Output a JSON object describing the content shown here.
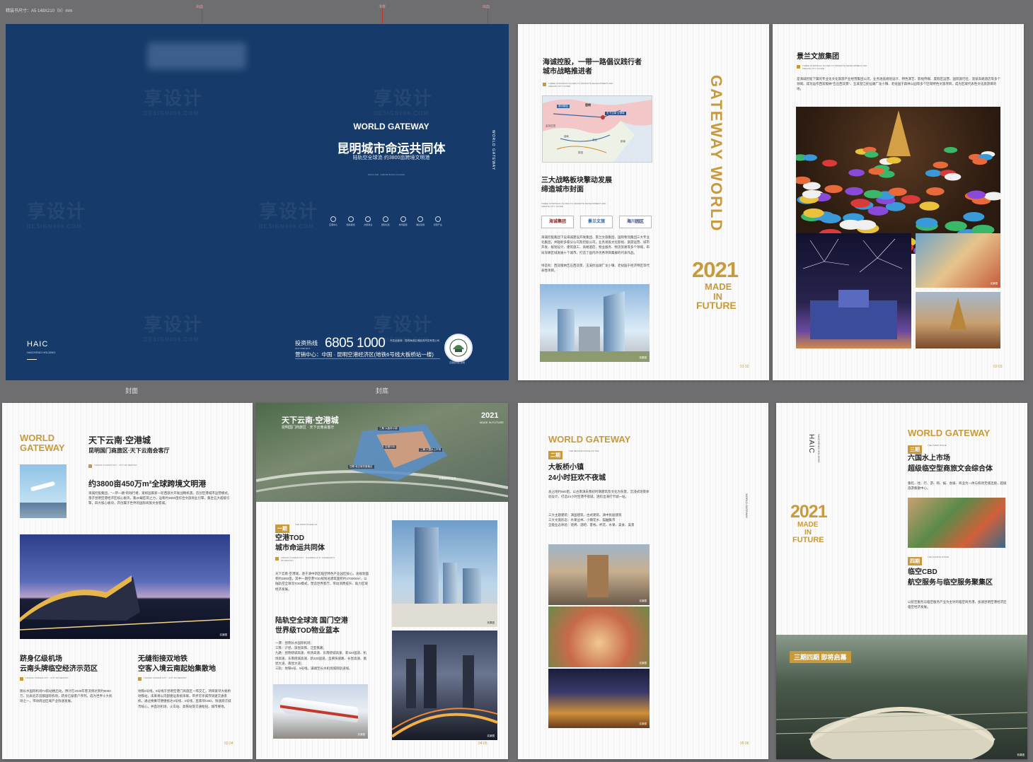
{
  "spec_label": "精装书尺寸：A5 148X210（h）mm",
  "guide_labels": [
    "出血",
    "书脊",
    "出血"
  ],
  "cover": {
    "world_gateway": "WORLD GATEWAY",
    "title": "昆明城市命运共同体",
    "subtitle": "陆轨空全球流·约3800亩跨境文明港",
    "tiny_en": "Airport Hub · Cultural Tourism Complex",
    "feature_icons": [
      "空港中心",
      "陆轨枢纽",
      "文旅商业",
      "国际社区",
      "休闲度假",
      "跨境贸易",
      "智慧产业"
    ],
    "hotline_label": "投资热线",
    "hotline_en": "HOT LINE 0871",
    "phone": "6805 1000",
    "developer": "开发运营商：昆明海诚空港投资开发有限公司",
    "sales_center": "营销中心：中国 · 昆明空港经济区(地铁6号线大板桥站一楼)",
    "brand": "HAIC",
    "brand_sub": "HAICHENG HOLDING",
    "spine": "WORLD GATEWAY",
    "seal_text": "空港经济区·昆明",
    "label_front": "封面",
    "label_back": "封底"
  },
  "p1": {
    "title": "海诚控股，一带一路倡议践行者\n城市战略推进者",
    "title_en": "THREE STRATEGIC PLATES TO PROMOTE DEVELOPMENT AND CREATE CITY COVER",
    "map_labels": [
      "昆明",
      "滇中新区",
      "天下云南·空港城",
      "孟加拉国",
      "缅甸",
      "老挝",
      "泰国",
      "越南"
    ],
    "heading2": "三大战略板块擎动发展\n缔造城市封面",
    "logos": [
      "海诚集团",
      "景兰文旅",
      "海川园区"
    ],
    "body": "海诚控股集团下设海诚建设开发集团、景兰文旅集团、国际物流集团三大专业化集团，并辐射多家分公司及控股公司，业务涵盖文化影视、旅游运营、城市开发、规划设计、建筑施工、高端酒店、物业服务、物流贸易等多个领域，布局深耕区域发展十个城市，打造了国内外优秀项目集群的代表作品。",
    "body2": "缔造有：西双版纳告庄西双景、玉溪抚仙湖广龙小镇、老挝国于经济特区等代表性项目。",
    "caption": "效果图",
    "vertical": "GATEWAY WORLD",
    "year": "2021",
    "made": "MADE",
    "in": "IN",
    "future": "FUTURE",
    "page_num": "01 02"
  },
  "p2": {
    "title": "景兰文旅集团",
    "title_en": "THREE STRATEGIC PLATES TO PROMOTE DEVELOPMENT AND CREATE CITY COVER",
    "body": "是海诚控股下属的专业化文化旅游产业经营集团公司，业务涵盖规划设计、特色演艺、影视传媒、度假区运营、国际旅行社、温泉高端酒店等多个领域。成功运作西双版纳\"告庄西双景\"、玉溪澄江抚仙湖广龙小镇、老挝国于森林公园等多个区域特色文旅项目，成为区域代表性文化旅游目的地。",
    "caption": "实景图",
    "page_num": "02 03"
  },
  "p3": {
    "world": "WORLD",
    "gateway": "GATEWAY",
    "title": "天下云南·空港城",
    "subtitle": "昆明国门商旅区·天下云南会客厅",
    "tiny_en": "TIANXIA YUNNAN CITY · CITY OF DESTINY",
    "heading": "约3800亩450万m²全球跨境文明港",
    "body": "海诚控股集团，\"一带一路\"的践行者，紧抓国家新一轮西部大开发战略机遇，首创空港城市运营模式，落子昆明空港经济区核心板块，集20载匠筑之力，运筹约3800亩综合文旅商业引擎，集合五大超级引擎，四大核心板块，开创属于世界的国际商旅文会客城。",
    "caption": "实景图",
    "col1_title": "跻身亿级机场\n云南头牌临空经济示范区",
    "col1_en": "TIANXIA YUNNAN CITY · CITY OF DESTINY",
    "col1_body": "随长水国际机场T2航站楼启动，预计在2030年客流将达到约9000万，比肩北京首都国际机场，跻身亿级客户序列，成为世界十大机场之一，带动周边区域产业快速发展。",
    "col2_title": "无缝衔接双地铁\n空客入境云南起始集散地",
    "col2_en": "TIANXIA YUNNAN CITY · CITY OF DESTINY",
    "col2_body": "地铁6号线，9号线于昆明空港门商旅区一阵交汇。项目紧邻大板桥地铁站，未来将以内部捷运系统串联，带步可享城市快速交通系统，通过换乘可便捷抵达3号线、4号线、巫家坝CBD，快速跃迁城市核心，并直达机场、火车站、高铁站等交通枢纽，城市要地。",
    "page_num": "03 04"
  },
  "p4": {
    "top_title": "天下云南·空港城",
    "top_sub": "昆明国门商旅区 · 天下云南会客厅",
    "top_year": "2021",
    "top_made": "MADE IN FUTURE",
    "aerial_labels": [
      "三期·大板桥小镇",
      "空港TOD",
      "四期·临空服务集聚区",
      "二期·六国水上市场"
    ],
    "aerial_caption": "效果图仅供参考",
    "tag": "一期",
    "tag_en": "THE FIRST PHASE OF",
    "heading": "空港TOD\n城市命运共同体",
    "tiny_en": "TIANXIA YUNNAN CITY · KUNMING CITY COMMUNITY OF DESTINY",
    "body": "天下云南·空港城，逐于滇中新区临空特色产业园区核心，总规划面积约3800亩，其中一期空港TOD规划总建筑面积约470000m²，以陆轨空全球流TOD模式，塑造世界客厅，带动消费提升、助力区域经济发展。",
    "heading2": "陆轨空全球流 国门空港\n世界级TOD物业蓝本",
    "body2": "一港：昆明长水国际机场；\n三铁：沪昆、渝昆高铁、泛亚铁路；\n九路：昆明绕城高速、机场高速、东南绕城高速、新320国道、机场高速、东南绕城高速、新320国道、呈黄快速路、长昆高速、嵩昆大道、南昆大道；\n三轨：地铁6号、9号线，满湖至长水机场城际轨道线。",
    "captions": [
      "效果图",
      "实景图",
      "实景图"
    ],
    "page_num": "04 05"
  },
  "p5": {
    "title": "WORLD GATEWAY",
    "tag": "二期",
    "tag_en": "THE SECOND PHASE OF THE",
    "heading": "大板桥小镇\n24小时狂欢不夜城",
    "body": "总占地约560亩，以古南滇未我初时期建筑及文化为背景，沉浸式场景体验设计，打造24小时空港不夜城，逐阶出海打卡城一站。",
    "list": "三大主题建筑：滇国建筑、古式建筑、滇中民居建筑\n三大文旅形态：水果丛林、小镇花乡、猫鼬集市\n全能业态体验：烧烤、酒吧、客栈、杯花、水果、美食、美景",
    "spine": "WORLD GATEWAY",
    "captions": [
      "实景图",
      "实景图",
      "实景图"
    ],
    "page_num": "05 06"
  },
  "p6": {
    "vertical_brand": "HAIC",
    "vertical_sub": "HAICHENG HOLDING",
    "year": "2021",
    "made": "MADE",
    "in": "IN",
    "future": "FUTURE",
    "title": "WORLD GATEWAY",
    "tag3": "三期",
    "tag3_en": "THE THIRD STAGE",
    "heading3": "六国水上市场\n超级临空型商旅文会综合体",
    "body3": "集吃、住、行、游、购、娱、会展、商业为一体与机场无缝连接，超级旅游集散中心。",
    "tag4": "四期",
    "tag4_en": "THE FOURTH STAGE",
    "heading4": "临空CBD\n航空服务与临空服务聚集区",
    "body4": "以航空服务与临空服务产业为主导的临空商务港，加速昆明空港经济区临空经济发展。",
    "banner": "三期四期 即将启幕",
    "caption": "效果图",
    "page_num": "07 08"
  },
  "watermark": {
    "cn": "享设计",
    "en": "DESIGN006.COM"
  }
}
